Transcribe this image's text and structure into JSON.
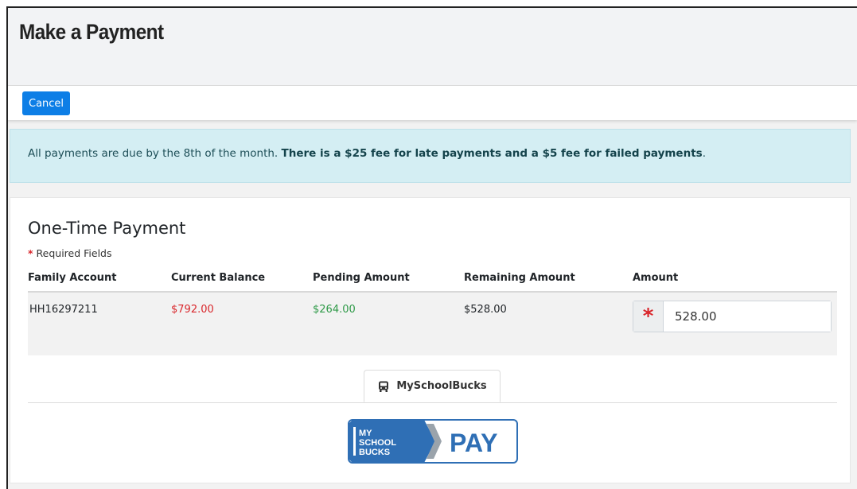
{
  "header": {
    "title": "Make a Payment"
  },
  "toolbar": {
    "cancel_label": "Cancel"
  },
  "alert": {
    "text_normal": "All payments are due by the 8th of the month. ",
    "text_bold": "There is a $25 fee for late payments and a $5 fee for failed payments",
    "text_end": "."
  },
  "card": {
    "title": "One-Time Payment",
    "required_note": "Required Fields",
    "required_star": "*"
  },
  "table": {
    "columns": [
      "Family Account",
      "Current Balance",
      "Pending Amount",
      "Remaining Amount",
      "Amount"
    ],
    "row": {
      "family_account": "HH16297211",
      "current_balance": "$792.00",
      "pending_amount": "$264.00",
      "remaining_amount": "$528.00",
      "amount_value": "528.00",
      "amount_prefix": "*"
    }
  },
  "tabs": [
    {
      "label": "MySchoolBucks",
      "icon": "bus-icon"
    }
  ],
  "pay_logo": {
    "line1": "MY",
    "line2": "SCHOOL",
    "line3": "BUCKS",
    "word": "PAY"
  },
  "colors": {
    "primary": "#0d7ee6",
    "danger": "#d9262b",
    "success": "#2f9a48",
    "alert_bg": "#d4eef3",
    "logo_blue": "#2f6fb5"
  }
}
